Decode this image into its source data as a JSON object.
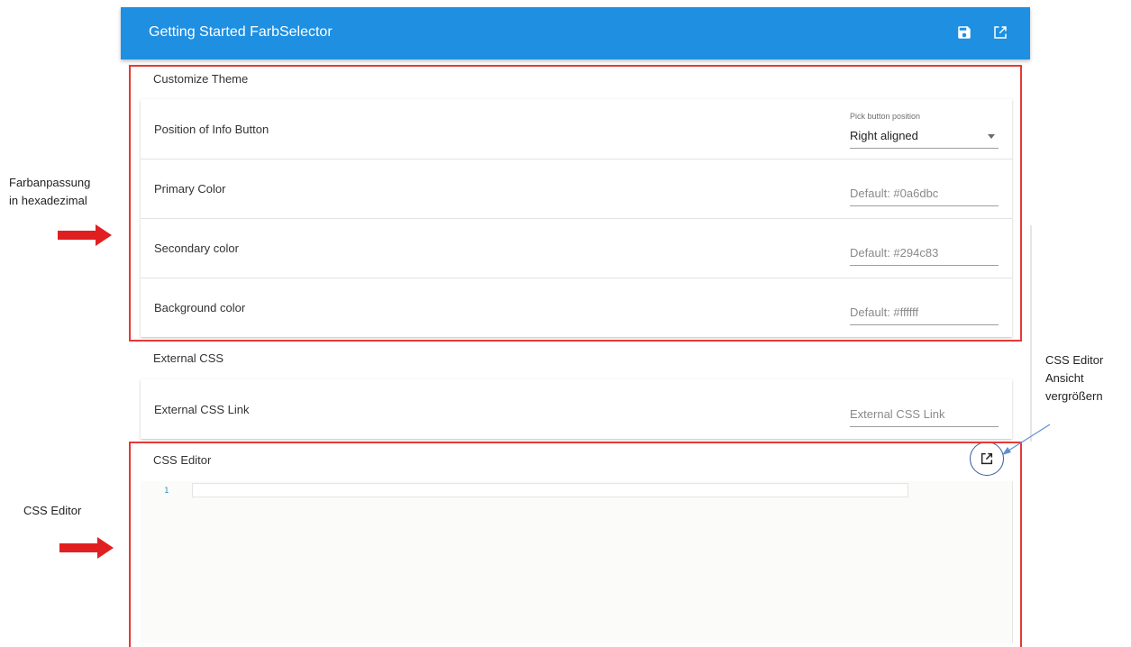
{
  "appbar": {
    "title": "Getting Started FarbSelector",
    "save_icon": "save-icon",
    "open_icon": "open-in-new-icon",
    "color": "#1e8fe1"
  },
  "customize_theme": {
    "title": "Customize Theme",
    "info_button": {
      "label": "Position of Info Button",
      "select_label": "Pick button position",
      "select_value": "Right aligned"
    },
    "primary": {
      "label": "Primary Color",
      "placeholder": "Default: #0a6dbc"
    },
    "secondary": {
      "label": "Secondary color",
      "placeholder": "Default: #294c83"
    },
    "background": {
      "label": "Background color",
      "placeholder": "Default: #ffffff"
    }
  },
  "external_css": {
    "title": "External CSS",
    "link": {
      "label": "External CSS Link",
      "placeholder": "External CSS Link"
    }
  },
  "css_editor": {
    "title": "CSS Editor",
    "line_number": "1",
    "expand_icon": "open-in-new-icon"
  },
  "annotations": {
    "left_top_line1": "Farbanpassung",
    "left_top_line2": "in hexadezimal",
    "left_bottom": "CSS Editor",
    "right_line1": "CSS Editor",
    "right_line2": "Ansicht",
    "right_line3": "vergrößern",
    "highlight_color": "#e53935",
    "arrow_color": "#e02020"
  }
}
